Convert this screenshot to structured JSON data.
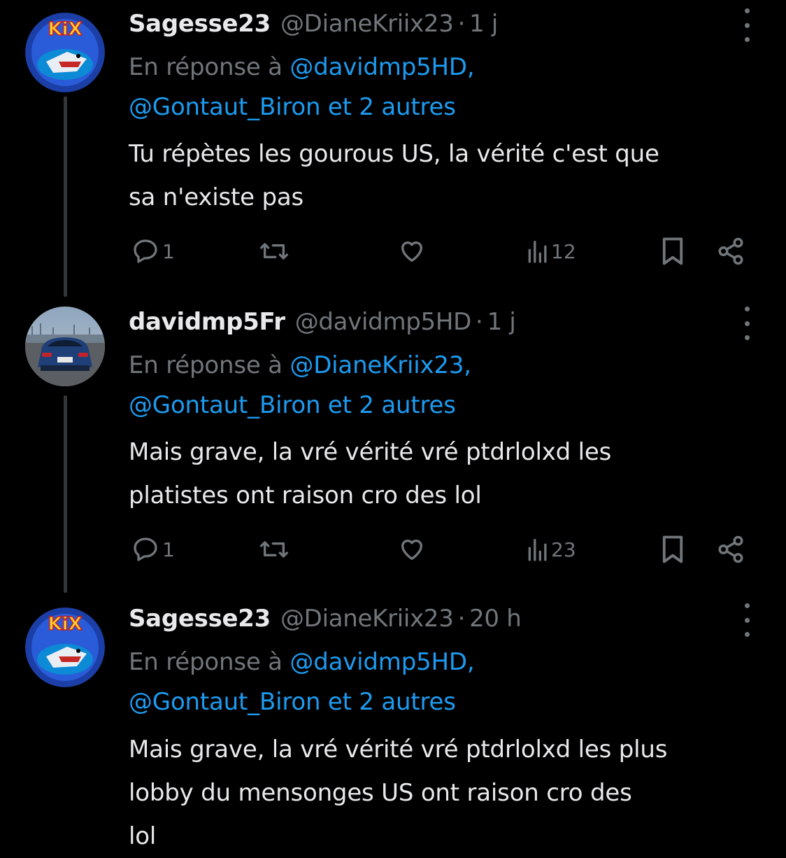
{
  "tweets": [
    {
      "name": "Sagesse23",
      "handle": "@DianeKriix23",
      "separator": "·",
      "time": "1 j",
      "reply_prefix": "En réponse à ",
      "reply_to_first": "@davidmp5HD,",
      "reply_to_rest": "@Gontaut_Biron et 2 autres",
      "text_line1": "Tu répètes les gourous US, la vérité c'est que",
      "text_line2": "sa n'existe pas",
      "text_line3": "",
      "replies": "1",
      "views": "12",
      "avatar": "kix-logo-avatar",
      "avatar_text": "KiX"
    },
    {
      "name": "davidmp5Fr",
      "handle": "@davidmp5HD",
      "separator": "·",
      "time": "1 j",
      "reply_prefix": "En réponse à ",
      "reply_to_first": "@DianeKriix23,",
      "reply_to_rest": "@Gontaut_Biron et 2 autres",
      "text_line1": "Mais grave, la vré vérité vré ptdrlolxd les",
      "text_line2": "platistes ont raison cro des lol",
      "text_line3": "",
      "replies": "1",
      "views": "23",
      "avatar": "car-photo-avatar"
    },
    {
      "name": "Sagesse23",
      "handle": "@DianeKriix23",
      "separator": "·",
      "time": "20 h",
      "reply_prefix": "En réponse à ",
      "reply_to_first": "@davidmp5HD,",
      "reply_to_rest": "@Gontaut_Biron et 2 autres",
      "text_line1": "Mais grave, la vré vérité vré ptdrlolxd les plus",
      "text_line2": "lobby du mensonges US ont raison cro des",
      "text_line3": "lol",
      "avatar": "kix-logo-avatar",
      "avatar_text": "KiX"
    }
  ],
  "icons": {
    "reply": "reply-icon",
    "retweet": "retweet-icon",
    "like": "like-icon",
    "views": "views-icon",
    "bookmark": "bookmark-icon",
    "share": "share-icon",
    "more": "more-icon"
  },
  "colors": {
    "background": "#000000",
    "text": "#e7e9ea",
    "secondary": "#71767b",
    "link": "#1d9bf0",
    "thread_line": "#333639"
  }
}
